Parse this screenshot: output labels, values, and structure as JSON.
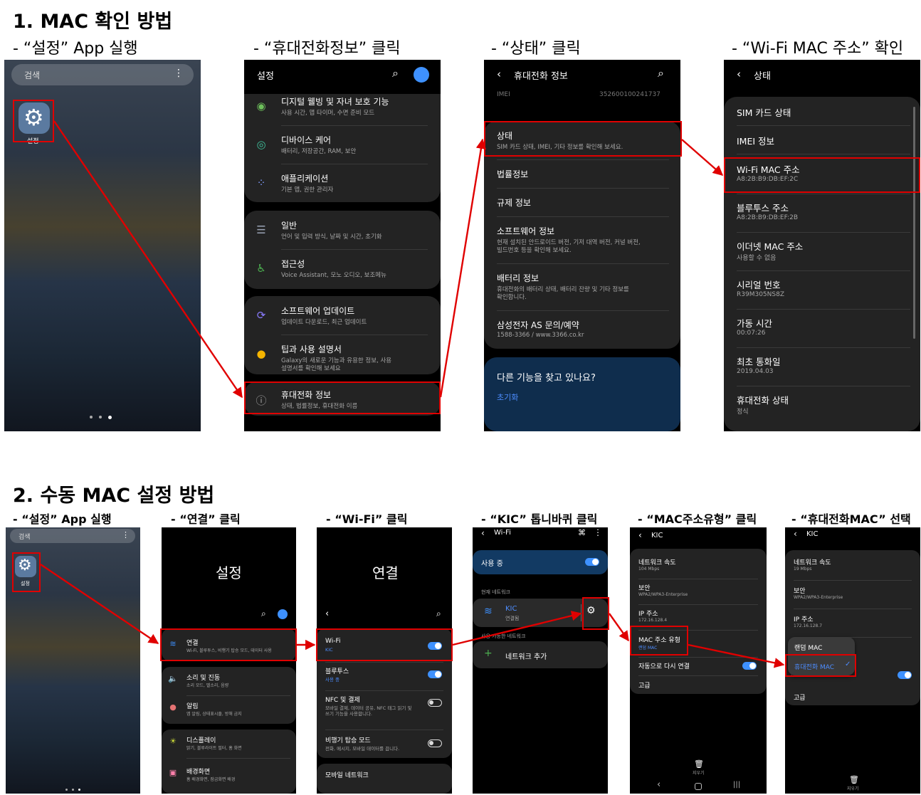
{
  "section1": {
    "title": "1. MAC 확인 방법",
    "steps": [
      "- “설정” App 실행",
      "- “휴대전화정보” 클릭",
      "- “상태” 클릭",
      "- “Wi-Fi MAC 주소” 확인"
    ]
  },
  "section2": {
    "title": "2. 수동 MAC 설정 방법",
    "steps": [
      "- “설정” App 실행",
      "- “연결” 클릭",
      "- “Wi-Fi” 클릭",
      "- “KIC” 톱니바퀴 클릭",
      "- “MAC주소유형” 클릭",
      "- “휴대전화MAC” 선택"
    ]
  },
  "home": {
    "search": "검색",
    "settings_label": "설정"
  },
  "settings": {
    "title": "설정",
    "items": [
      {
        "title": "디지털 웰빙 및 자녀 보호 기능",
        "sub": "사용 시간, 앱 타이머, 수면 준비 모드"
      },
      {
        "title": "디바이스 케어",
        "sub": "배터리, 저장공간, RAM, 보안"
      },
      {
        "title": "애플리케이션",
        "sub": "기본 앱, 권한 관리자"
      },
      {
        "title": "일반",
        "sub": "언어 및 입력 방식, 날짜 및 시간, 초기화"
      },
      {
        "title": "접근성",
        "sub": "Voice Assistant, 모노 오디오, 보조메뉴"
      },
      {
        "title": "소프트웨어 업데이트",
        "sub": "업데이트 다운로드, 최근 업데이트"
      },
      {
        "title": "팁과 사용 설명서",
        "sub": "Galaxy의 새로운 기능과 유용한 정보, 사용",
        "sub2": "설명서를 확인해 보세요"
      },
      {
        "title": "휴대전화 정보",
        "sub": "상태, 법률정보, 휴대전화 이름"
      }
    ]
  },
  "phoneinfo": {
    "title": "휴대전화 정보",
    "imei_top": "IMEI",
    "imei_val": "352600100241737",
    "items": [
      {
        "title": "상태",
        "sub": "SIM 카드 상태, IMEI, 기타 정보를 확인해 보세요."
      },
      {
        "title": "법률정보"
      },
      {
        "title": "규제 정보"
      },
      {
        "title": "소프트웨어 정보",
        "sub": "현재 설치된 안드로이드 버전, 기저 대역 버전, 커널 버전,",
        "sub2": "빌드번호 등을 확인해 보세요."
      },
      {
        "title": "배터리 정보",
        "sub": "휴대전화의 배터리 상태, 배터리 잔량 및 기타 정보를",
        "sub2": "확인합니다."
      },
      {
        "title": "삼성전자 AS 문의/예약",
        "sub": "1588-3366 / www.3366.co.kr"
      }
    ],
    "looking": "다른 기능을 찾고 있나요?",
    "reset": "초기화"
  },
  "status": {
    "title": "상태",
    "items": [
      {
        "title": "SIM 카드 상태"
      },
      {
        "title": "IMEI 정보"
      },
      {
        "title": "Wi-Fi MAC 주소",
        "sub": "A8:2B:B9:DB:EF:2C"
      },
      {
        "title": "블루투스 주소",
        "sub": "A8:2B:B9:DB:EF:2B"
      },
      {
        "title": "이더넷 MAC 주소",
        "sub": "사용할 수 없음"
      },
      {
        "title": "시리얼 번호",
        "sub": "R39M305NS8Z"
      },
      {
        "title": "가동 시간",
        "sub": "00:07:26"
      },
      {
        "title": "최초 통화일",
        "sub": "2019.04.03"
      },
      {
        "title": "휴대전화 상태",
        "sub": "정식"
      }
    ]
  },
  "conn_settings": {
    "title": "설정",
    "items": [
      {
        "title": "연결",
        "sub": "Wi-Fi, 블루투스, 비행기 탑승 모드, 데이터 사용"
      },
      {
        "title": "소리 및 진동",
        "sub": "소리 모드, 벨소리, 음량"
      },
      {
        "title": "알림",
        "sub": "앱 알림, 상태표시줄, 방해 금지"
      },
      {
        "title": "디스플레이",
        "sub": "밝기, 블루라이트 필터, 홈 화면"
      },
      {
        "title": "배경화면",
        "sub": "홈 배경화면, 잠금화면 배경"
      }
    ]
  },
  "connections": {
    "title": "연결",
    "items": [
      {
        "title": "Wi-Fi",
        "sub": "KIC"
      },
      {
        "title": "블루투스",
        "sub": "사용 중"
      },
      {
        "title": "NFC 및 결제",
        "sub": "모바일 결제, 데이터 공유, NFC 태그 읽기 및",
        "sub2": "쓰기 기능을 사용합니다."
      },
      {
        "title": "비행기 탑승 모드",
        "sub": "전화, 메시지, 모바일 데이터를 끕니다."
      },
      {
        "title": "모바일 네트워크"
      }
    ]
  },
  "wifi": {
    "title": "Wi-Fi",
    "in_use": "사용 중",
    "current": "현재 네트워크",
    "net": "KIC",
    "net_status": "연결됨",
    "available": "사용 가능한 네트워크",
    "add": "네트워크 추가"
  },
  "kic": {
    "title": "KIC",
    "items": [
      {
        "title": "네트워크 속도",
        "sub": "104 Mbps"
      },
      {
        "title": "보안",
        "sub": "WPA2/WPA3-Enterprise"
      },
      {
        "title": "IP 주소",
        "sub": "172.16.128.4"
      },
      {
        "title": "MAC 주소 유형",
        "sub": "랜덤 MAC"
      },
      {
        "title": "자동으로 다시 연결"
      },
      {
        "title": "고급"
      }
    ],
    "delete": "지우기"
  },
  "kic2": {
    "title": "KIC",
    "items": [
      {
        "title": "네트워크 속도",
        "sub": "19 Mbps"
      },
      {
        "title": "보안",
        "sub": "WPA2/WPA3-Enterprise"
      },
      {
        "title": "IP 주소",
        "sub": "172.16.128.7"
      },
      {
        "title": "고급"
      }
    ],
    "popup": [
      "랜덤 MAC",
      "휴대전화 MAC"
    ],
    "hidden": "자동으로 다시 연결",
    "delete": "지우기"
  },
  "colors": {
    "accent": "#3e91ff",
    "highlight": "#e00000",
    "card": "#232323"
  }
}
